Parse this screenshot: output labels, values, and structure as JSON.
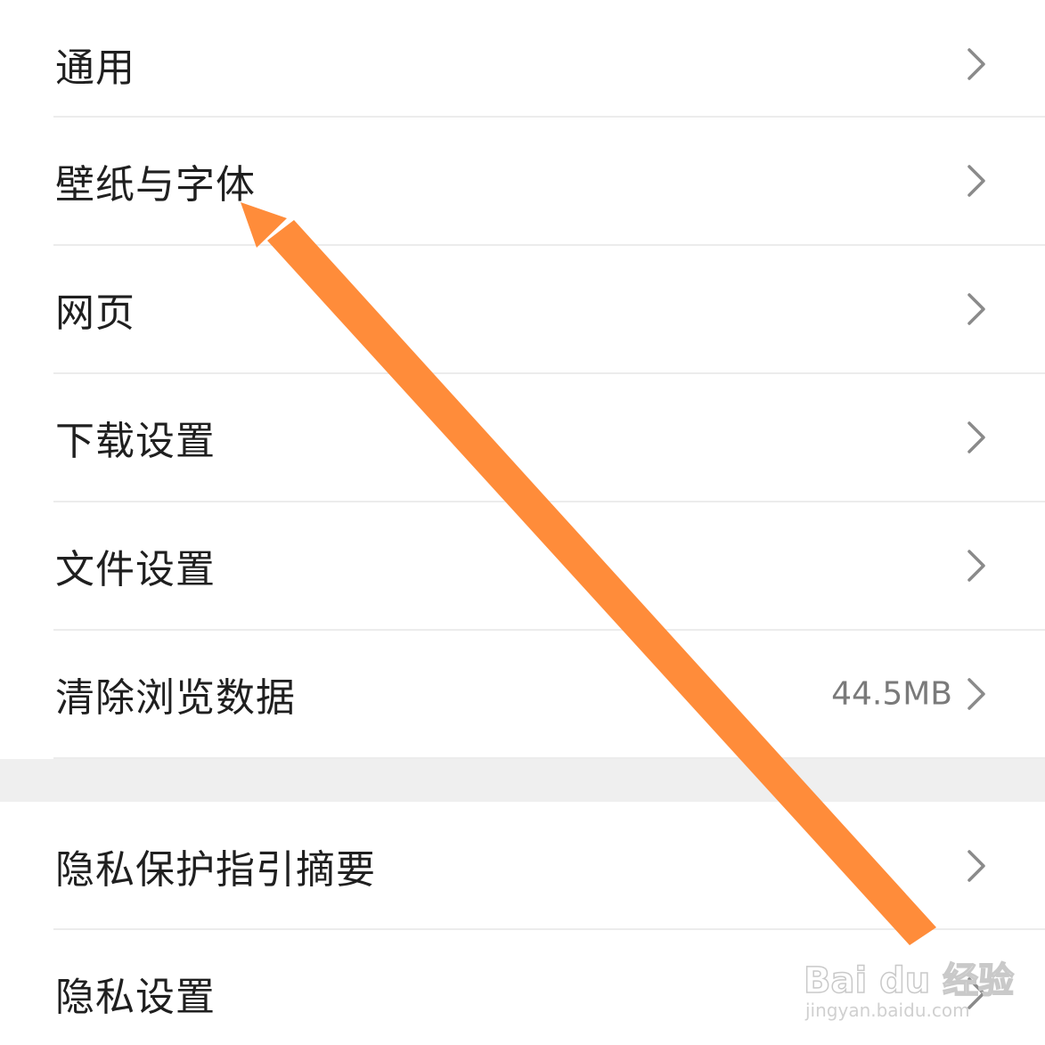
{
  "settings": {
    "items": [
      {
        "label": "通用",
        "value": "",
        "icon": "chevron-right-icon"
      },
      {
        "label": "壁纸与字体",
        "value": "",
        "icon": "chevron-right-icon"
      },
      {
        "label": "网页",
        "value": "",
        "icon": "chevron-right-icon"
      },
      {
        "label": "下载设置",
        "value": "",
        "icon": "chevron-right-icon"
      },
      {
        "label": "文件设置",
        "value": "",
        "icon": "chevron-right-icon"
      },
      {
        "label": "清除浏览数据",
        "value": "44.5MB",
        "icon": "chevron-right-icon"
      }
    ],
    "privacy_items": [
      {
        "label": "隐私保护指引摘要",
        "value": "",
        "icon": "chevron-right-icon"
      },
      {
        "label": "隐私设置",
        "value": "",
        "icon": "chevron-right-icon"
      }
    ]
  },
  "annotation": {
    "type": "arrow",
    "color": "#ff8c3a",
    "points_to": "壁纸与字体"
  },
  "watermark": {
    "brand": "Bai du 经验",
    "url": "jingyan.baidu.com"
  },
  "colors": {
    "background": "#ffffff",
    "section_gap": "#efefef",
    "divider": "#ececec",
    "label_text": "#1f1f1f",
    "value_text": "#7a7a7a",
    "chevron": "#8a8a8a"
  }
}
